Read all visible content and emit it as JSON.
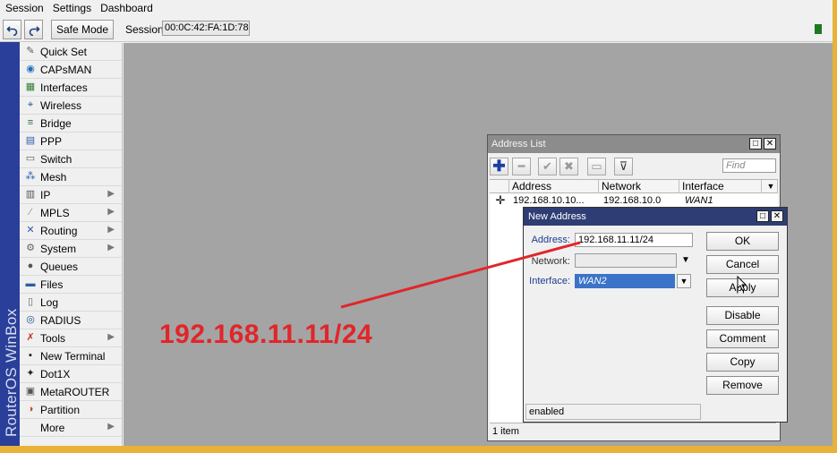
{
  "menubar": {
    "items": [
      "Session",
      "Settings",
      "Dashboard"
    ]
  },
  "toolbar": {
    "undo_icon": "undo-icon",
    "redo_icon": "redo-icon",
    "safe_mode_label": "Safe Mode",
    "session_label": "Session:",
    "session_value": "00:0C:42:FA:1D:78"
  },
  "brand": {
    "text": "RouterOS WinBox"
  },
  "sidebar": {
    "items": [
      {
        "label": "Quick Set",
        "icon": "quick-set-icon",
        "submenu": false
      },
      {
        "label": "CAPsMAN",
        "icon": "capsman-icon",
        "submenu": false
      },
      {
        "label": "Interfaces",
        "icon": "interfaces-icon",
        "submenu": false
      },
      {
        "label": "Wireless",
        "icon": "wireless-icon",
        "submenu": false
      },
      {
        "label": "Bridge",
        "icon": "bridge-icon",
        "submenu": false
      },
      {
        "label": "PPP",
        "icon": "ppp-icon",
        "submenu": false
      },
      {
        "label": "Switch",
        "icon": "switch-icon",
        "submenu": false
      },
      {
        "label": "Mesh",
        "icon": "mesh-icon",
        "submenu": false
      },
      {
        "label": "IP",
        "icon": "ip-icon",
        "submenu": true
      },
      {
        "label": "MPLS",
        "icon": "mpls-icon",
        "submenu": true
      },
      {
        "label": "Routing",
        "icon": "routing-icon",
        "submenu": true
      },
      {
        "label": "System",
        "icon": "system-icon",
        "submenu": true
      },
      {
        "label": "Queues",
        "icon": "queues-icon",
        "submenu": false
      },
      {
        "label": "Files",
        "icon": "files-icon",
        "submenu": false
      },
      {
        "label": "Log",
        "icon": "log-icon",
        "submenu": false
      },
      {
        "label": "RADIUS",
        "icon": "radius-icon",
        "submenu": false
      },
      {
        "label": "Tools",
        "icon": "tools-icon",
        "submenu": true
      },
      {
        "label": "New Terminal",
        "icon": "terminal-icon",
        "submenu": false
      },
      {
        "label": "Dot1X",
        "icon": "dot1x-icon",
        "submenu": false
      },
      {
        "label": "MetaROUTER",
        "icon": "metarouter-icon",
        "submenu": false
      },
      {
        "label": "Partition",
        "icon": "partition-icon",
        "submenu": false
      },
      {
        "label": "More",
        "icon": "",
        "submenu": true
      }
    ]
  },
  "address_list": {
    "title": "Address List",
    "find_placeholder": "Find",
    "columns": [
      "Address",
      "Network",
      "Interface"
    ],
    "rows": [
      {
        "address": "192.168.10.10...",
        "network": "192.168.10.0",
        "interface": "WAN1"
      }
    ],
    "status": "1 item"
  },
  "new_address": {
    "title": "New Address",
    "address_label": "Address:",
    "address_value": "192.168.11.11/24",
    "network_label": "Network:",
    "network_value": "",
    "interface_label": "Interface:",
    "interface_value": "WAN2",
    "buttons": {
      "ok": "OK",
      "cancel": "Cancel",
      "apply": "Apply",
      "disable": "Disable",
      "comment": "Comment",
      "copy": "Copy",
      "remove": "Remove"
    },
    "status": "enabled"
  },
  "annotation": {
    "text": "192.168.11.11/24",
    "color": "#e0262a"
  },
  "colors": {
    "brand": "#2a3f9a",
    "dialog_title": "#2e3e74",
    "workspace": "#a4a4a4",
    "outer_border": "#e8b23a"
  }
}
